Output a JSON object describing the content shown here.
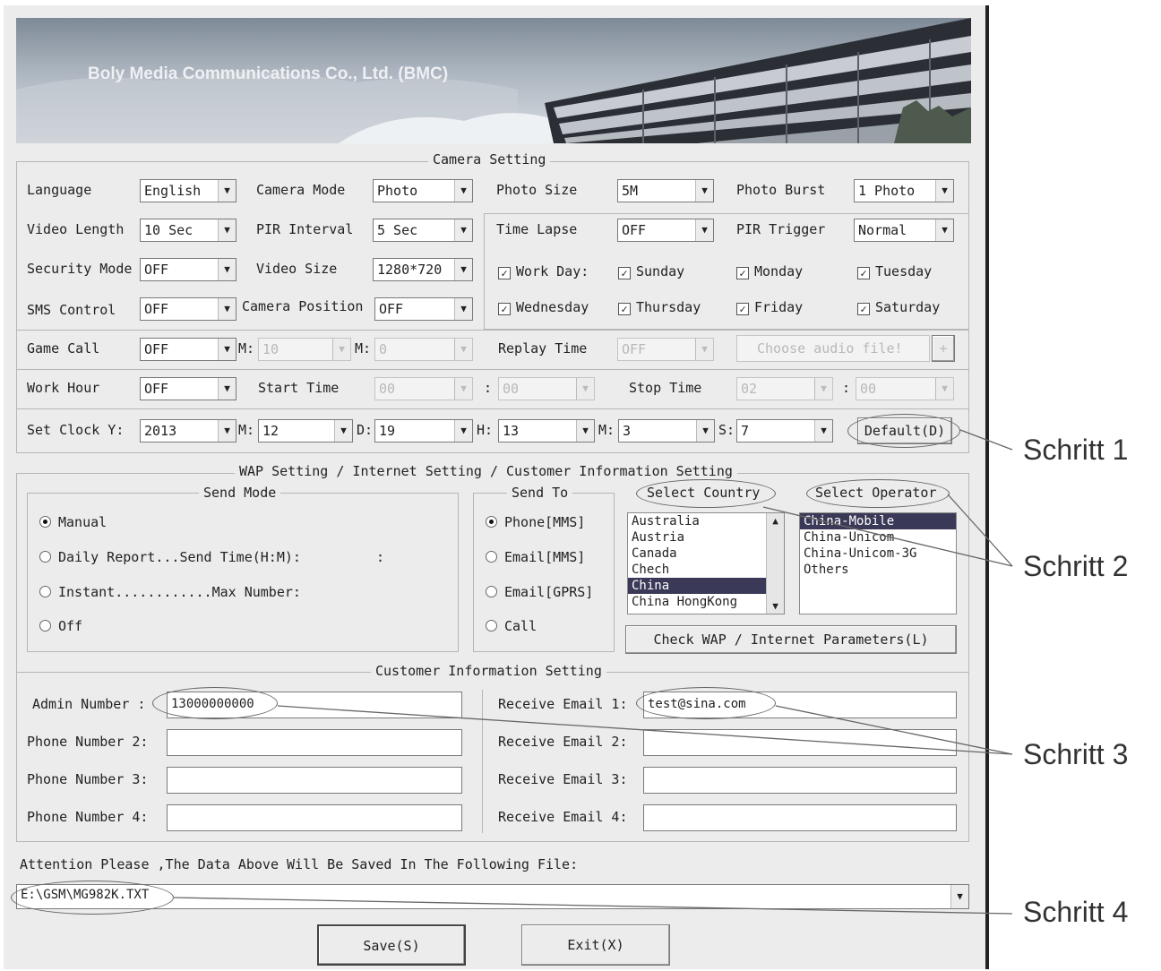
{
  "banner": {
    "company": "Boly Media Communications Co., Ltd. (BMC)"
  },
  "camera": {
    "legend": "Camera Setting",
    "language": {
      "label": "Language",
      "value": "English"
    },
    "camera_mode": {
      "label": "Camera Mode",
      "value": "Photo"
    },
    "photo_size": {
      "label": "Photo Size",
      "value": "5M"
    },
    "photo_burst": {
      "label": "Photo Burst",
      "value": "1 Photo"
    },
    "video_length": {
      "label": "Video Length",
      "value": "10  Sec"
    },
    "pir_interval": {
      "label": "PIR Interval",
      "value": "5  Sec"
    },
    "time_lapse": {
      "label": "Time Lapse",
      "value": "OFF"
    },
    "pir_trigger": {
      "label": "PIR Trigger",
      "value": "Normal"
    },
    "security_mode": {
      "label": "Security Mode",
      "value": "OFF"
    },
    "video_size": {
      "label": "Video Size",
      "value": "1280*720"
    },
    "work_day": {
      "label": "Work Day:",
      "checked": true
    },
    "days": [
      {
        "label": "Sunday",
        "checked": true
      },
      {
        "label": "Monday",
        "checked": true
      },
      {
        "label": "Tuesday",
        "checked": true
      },
      {
        "label": "Wednesday",
        "checked": true
      },
      {
        "label": "Thursday",
        "checked": true
      },
      {
        "label": "Friday",
        "checked": true
      },
      {
        "label": "Saturday",
        "checked": true
      }
    ],
    "sms_control": {
      "label": "SMS Control",
      "value": "OFF"
    },
    "camera_position": {
      "label": "Camera Position",
      "value": "OFF"
    },
    "game_call": {
      "label": "Game Call",
      "value": "OFF",
      "m_label": "M:",
      "m_value": "10",
      "s_label": "M:",
      "s_value": "0"
    },
    "replay_time": {
      "label": "Replay Time",
      "value": "OFF"
    },
    "audio_file": {
      "value": "Choose audio file!",
      "button": "+"
    },
    "work_hour": {
      "label": "Work Hour",
      "value": "OFF"
    },
    "start_time": {
      "label": "Start Time",
      "h": "00",
      "m": "00",
      "sep": ":"
    },
    "stop_time": {
      "label": "Stop Time",
      "h": "02",
      "m": "00",
      "sep": ":"
    },
    "clock": {
      "label": "Set Clock Y:",
      "y": "2013",
      "m_label": "M:",
      "m": "12",
      "d_label": "D:",
      "d": "19",
      "h_label": "H:",
      "h": "13",
      "min_label": "M:",
      "min": "3",
      "s_label": "S:",
      "s": "7"
    },
    "default_button": "Default(D)"
  },
  "wap": {
    "legend": "WAP Setting / Internet Setting / Customer Information Setting",
    "send_mode": {
      "legend": "Send Mode",
      "options": [
        "Manual",
        "Daily Report...Send Time(H:M):",
        "Instant............Max Number:",
        "Off"
      ],
      "selected": 0,
      "time_sep": ":"
    },
    "send_to": {
      "legend": "Send To",
      "options": [
        "Phone[MMS]",
        "Email[MMS]",
        "Email[GPRS]",
        "Call"
      ],
      "selected": 0
    },
    "country": {
      "legend": "Select Country",
      "items": [
        "Australia",
        "Austria",
        "Canada",
        "Chech",
        "China",
        "China HongKong"
      ],
      "selected": 4
    },
    "operator": {
      "legend": "Select Operator",
      "items": [
        "China-Mobile",
        "China-Unicom",
        "China-Unicom-3G",
        "Others"
      ],
      "selected": 0
    },
    "check_button": "Check WAP / Internet Parameters(L)"
  },
  "customer": {
    "legend": "Customer Information Setting",
    "phones": [
      {
        "label": "Admin Number :",
        "value": "13000000000"
      },
      {
        "label": "Phone Number 2:",
        "value": ""
      },
      {
        "label": "Phone Number 3:",
        "value": ""
      },
      {
        "label": "Phone Number 4:",
        "value": ""
      }
    ],
    "emails": [
      {
        "label": "Receive Email 1:",
        "value": "test@sina.com"
      },
      {
        "label": "Receive Email 2:",
        "value": ""
      },
      {
        "label": "Receive Email 3:",
        "value": ""
      },
      {
        "label": "Receive Email 4:",
        "value": ""
      }
    ]
  },
  "save_notice": "Attention Please ,The Data Above Will Be Saved In The Following  File:",
  "save_path": "E:\\GSM\\MG982K.TXT",
  "buttons": {
    "save": "Save(S)",
    "exit": "Exit(X)"
  },
  "annotations": [
    "Schritt 1",
    "Schritt 2",
    "Schritt 3",
    "Schritt 4"
  ]
}
